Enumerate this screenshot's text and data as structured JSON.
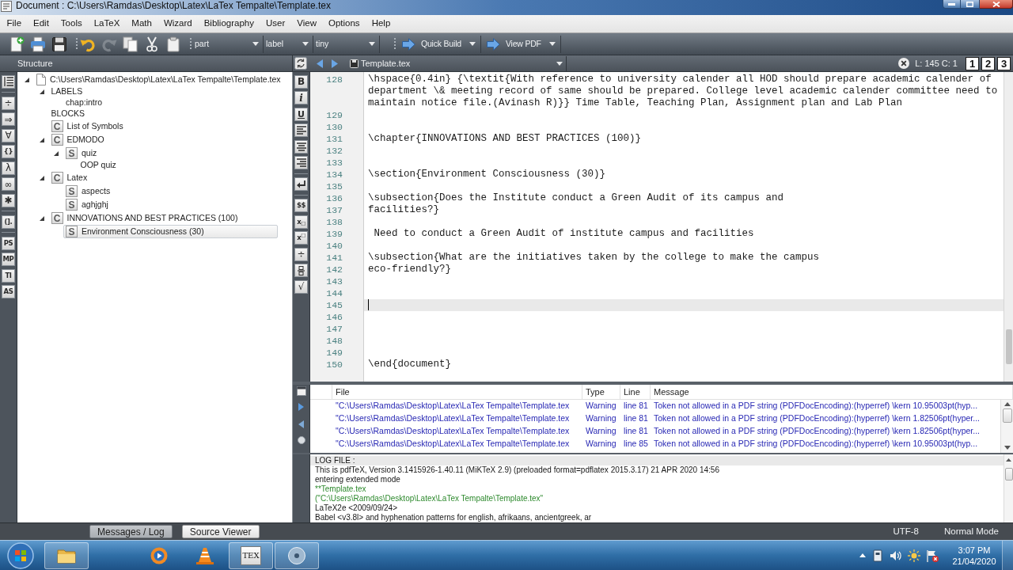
{
  "window": {
    "title": "Document : C:\\Users\\Ramdas\\Desktop\\Latex\\LaTex Tempalte\\Template.tex"
  },
  "menu": [
    "File",
    "Edit",
    "Tools",
    "LaTeX",
    "Math",
    "Wizard",
    "Bibliography",
    "User",
    "View",
    "Options",
    "Help"
  ],
  "toolbar": {
    "button_groups": [
      [
        {
          "kind": "new",
          "disabled": false
        },
        {
          "kind": "print",
          "disabled": false
        },
        {
          "kind": "save",
          "disabled": false
        }
      ],
      [
        {
          "kind": "undo",
          "disabled": false
        },
        {
          "kind": "redo",
          "disabled": true
        },
        {
          "kind": "copy",
          "disabled": false
        },
        {
          "kind": "cut",
          "disabled": false
        },
        {
          "kind": "paste",
          "disabled": false
        }
      ]
    ],
    "combos": [
      {
        "value": "part"
      },
      {
        "value": "label"
      },
      {
        "value": "tiny"
      }
    ],
    "actions": [
      {
        "label": "Quick Build"
      },
      {
        "label": "View PDF"
      }
    ]
  },
  "symbol_strip": [
    {
      "kind": "outline"
    },
    {
      "kind": "separator"
    },
    {
      "kind": "glyph",
      "label": "÷"
    },
    {
      "kind": "glyph",
      "label": "⇒"
    },
    {
      "kind": "glyph",
      "label": "∀"
    },
    {
      "kind": "glyph",
      "label": "{}"
    },
    {
      "kind": "glyph",
      "label": "λ"
    },
    {
      "kind": "glyph",
      "label": "∞"
    },
    {
      "kind": "glyph",
      "label": "✱"
    },
    {
      "kind": "separator"
    },
    {
      "kind": "glyph",
      "label": "(]."
    },
    {
      "kind": "separator"
    },
    {
      "kind": "glyph",
      "label": "PS"
    },
    {
      "kind": "glyph",
      "label": "MP"
    },
    {
      "kind": "glyph",
      "label": "TI"
    },
    {
      "kind": "glyph",
      "label": "AS"
    }
  ],
  "structure": {
    "title": "Structure",
    "tree": [
      {
        "label": "C:\\Users\\Ramdas\\Desktop\\Latex\\LaTex Tempalte\\Template.tex",
        "kind": "file",
        "expanded": true,
        "selected": false,
        "children": [
          {
            "label": "LABELS",
            "expanded": true,
            "selected": false,
            "children": [
              {
                "label": "chap:intro",
                "selected": false
              }
            ]
          },
          {
            "label": "BLOCKS",
            "selected": false
          },
          {
            "label": "List of Symbols",
            "kind": "chapter",
            "tag": "C",
            "selected": false
          },
          {
            "label": "EDMODO",
            "kind": "chapter",
            "tag": "C",
            "expanded": true,
            "selected": false,
            "children": [
              {
                "label": "quiz",
                "kind": "section",
                "tag": "S",
                "expanded": true,
                "selected": false,
                "children": [
                  {
                    "label": "OOP quiz",
                    "selected": false
                  }
                ]
              }
            ]
          },
          {
            "label": "Latex",
            "kind": "chapter",
            "tag": "C",
            "expanded": true,
            "selected": false,
            "children": [
              {
                "label": "aspects",
                "kind": "section",
                "tag": "S",
                "selected": false
              },
              {
                "label": "aghjghj",
                "kind": "section",
                "tag": "S",
                "selected": false
              }
            ]
          },
          {
            "label": "INNOVATIONS AND BEST PRACTICES (100)",
            "kind": "chapter",
            "tag": "C",
            "expanded": true,
            "selected": false,
            "children": [
              {
                "label": "Environment Consciousness (30)",
                "kind": "section",
                "tag": "S",
                "selected": true
              }
            ]
          }
        ]
      }
    ]
  },
  "editor": {
    "file_tab": "Template.tex",
    "position": "L: 145 C: 1",
    "view_buttons": [
      "1",
      "2",
      "3"
    ],
    "format_strip": [
      {
        "kind": "bold",
        "label": "B"
      },
      {
        "kind": "italic",
        "label": "i"
      },
      {
        "kind": "underline",
        "label": "U"
      },
      {
        "kind": "align-left"
      },
      {
        "kind": "align-center"
      },
      {
        "kind": "align-right"
      },
      {
        "kind": "separator"
      },
      {
        "kind": "newline"
      },
      {
        "kind": "separator"
      },
      {
        "kind": "glyph",
        "label": "$$"
      },
      {
        "kind": "glyph",
        "label": "x$_{□}$"
      },
      {
        "kind": "glyph",
        "label": "x$^{□}$"
      },
      {
        "kind": "glyph",
        "label": "÷"
      },
      {
        "kind": "fraction"
      },
      {
        "kind": "glyph",
        "label": "√"
      }
    ],
    "lines": [
      {
        "number": "128",
        "text": "\\hspace{0.4in} {\\textit{With reference to university calender all HOD should prepare academic calender of department \\& meeting record of same should be prepared. College level academic calender committee need to maintain notice file.(Avinash R)}} Time Table, Teaching Plan, Assignment plan and Lab Plan",
        "current": false
      },
      {
        "number": "129",
        "current": false
      },
      {
        "number": "130",
        "current": false
      },
      {
        "number": "131",
        "text": "\\chapter{INNOVATIONS AND BEST PRACTICES (100)}",
        "current": false
      },
      {
        "number": "132",
        "current": false
      },
      {
        "number": "133",
        "current": false
      },
      {
        "number": "134",
        "text": "\\section{Environment Consciousness (30)}",
        "current": false
      },
      {
        "number": "135",
        "current": false
      },
      {
        "number": "136",
        "text": "\\subsection{Does the Institute conduct a Green Audit of its campus and",
        "current": false
      },
      {
        "number": "137",
        "text": "facilities?}",
        "current": false
      },
      {
        "number": "138",
        "current": false
      },
      {
        "number": "139",
        "text": " Need to conduct a Green Audit of institute campus and facilities",
        "current": false
      },
      {
        "number": "140",
        "current": false
      },
      {
        "number": "141",
        "text": "\\subsection{What are the initiatives taken by the college to make the campus",
        "current": false
      },
      {
        "number": "142",
        "text": "eco-friendly?}",
        "current": false
      },
      {
        "number": "143",
        "current": false
      },
      {
        "number": "144",
        "current": false
      },
      {
        "number": "145",
        "current": true
      },
      {
        "number": "146",
        "current": false
      },
      {
        "number": "147",
        "current": false
      },
      {
        "number": "148",
        "current": false
      },
      {
        "number": "149",
        "current": false
      },
      {
        "number": "150",
        "text": "\\end{document}",
        "current": false
      }
    ]
  },
  "messages": {
    "columns": [
      "File",
      "Type",
      "Line",
      "Message"
    ],
    "rows": [
      {
        "file": "\"C:\\Users\\Ramdas\\Desktop\\Latex\\LaTex Tempalte\\Template.tex",
        "type": "Warning",
        "line": "line 81",
        "message": "Token not allowed in a PDF string (PDFDocEncoding):(hyperref) \\kern 10.95003pt(hyp..."
      },
      {
        "file": "\"C:\\Users\\Ramdas\\Desktop\\Latex\\LaTex Tempalte\\Template.tex",
        "type": "Warning",
        "line": "line 81",
        "message": "Token not allowed in a PDF string (PDFDocEncoding):(hyperref) \\kern 1.82506pt(hyper..."
      },
      {
        "file": "\"C:\\Users\\Ramdas\\Desktop\\Latex\\LaTex Tempalte\\Template.tex",
        "type": "Warning",
        "line": "line 81",
        "message": "Token not allowed in a PDF string (PDFDocEncoding):(hyperref) \\kern 1.82506pt(hyper..."
      },
      {
        "file": "\"C:\\Users\\Ramdas\\Desktop\\Latex\\LaTex Tempalte\\Template.tex",
        "type": "Warning",
        "line": "line 85",
        "message": "Token not allowed in a PDF string (PDFDocEncoding):(hyperref) \\kern 10.95003pt(hyp..."
      }
    ]
  },
  "log": {
    "title": "LOG FILE :",
    "lines": [
      {
        "text": "This is pdfTeX, Version 3.1415926-1.40.11 (MiKTeX 2.9) (preloaded format=pdflatex 2015.3.17) 21 APR 2020 14:56",
        "kind": "plain"
      },
      {
        "text": "entering extended mode",
        "kind": "plain"
      },
      {
        "text": "**Template.tex",
        "kind": "file"
      },
      {
        "text": "(\"C:\\Users\\Ramdas\\Desktop\\Latex\\LaTex Tempalte\\Template.tex\"",
        "kind": "file"
      },
      {
        "text": "LaTeX2e <2009/09/24>",
        "kind": "plain"
      },
      {
        "text": "Babel <v3.8l> and hyphenation patterns for english, afrikaans, ancientgreek, ar",
        "kind": "plain"
      }
    ]
  },
  "status_bar": {
    "toggles": [
      {
        "label": "Messages / Log",
        "on": true
      },
      {
        "label": "Source Viewer",
        "on": false
      }
    ],
    "encoding": "UTF-8",
    "mode": "Normal Mode"
  },
  "taskbar": {
    "apps": [
      {
        "kind": "folder",
        "running": true
      },
      {
        "kind": "media",
        "running": false
      },
      {
        "kind": "cone",
        "running": false
      },
      {
        "kind": "tex",
        "label": "TEX",
        "running": true
      },
      {
        "kind": "disc",
        "running": true
      }
    ],
    "time": "3:07 PM",
    "date": "21/04/2020"
  }
}
